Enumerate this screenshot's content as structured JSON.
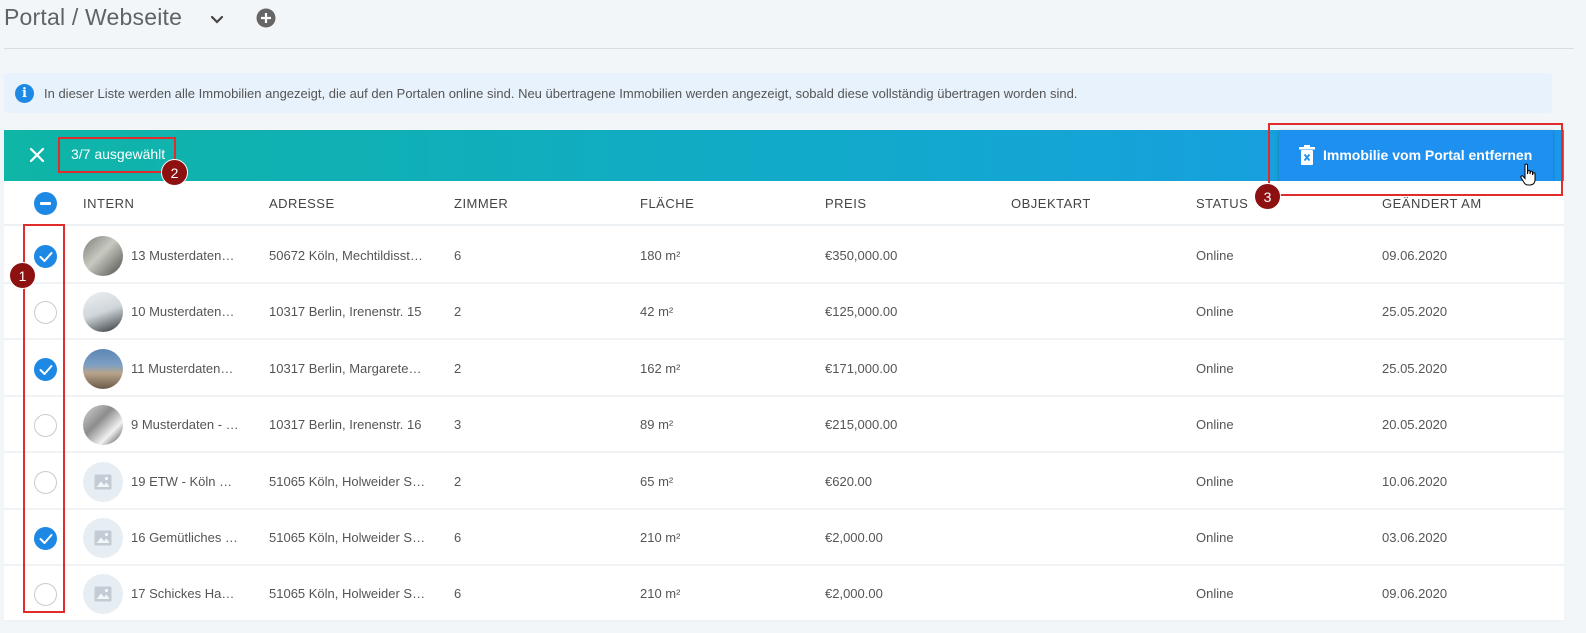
{
  "header": {
    "title": "Portal / Webseite",
    "dropdown_icon": "chevron-down-icon",
    "add_icon": "plus-circle-icon"
  },
  "info": {
    "text": "In dieser Liste werden alle Immobilien angezeigt, die auf den Portalen online sind. Neu übertragene Immobilien werden angezeigt, sobald diese vollständig übertragen worden sind."
  },
  "selection_bar": {
    "selected_text": "3/7 ausgewählt",
    "remove_button": "Immobilie vom Portal entfernen"
  },
  "table": {
    "columns": [
      "INTERN",
      "ADRESSE",
      "ZIMMER",
      "FLÄCHE",
      "PREIS",
      "OBJEKTART",
      "STATUS",
      "GEÄNDERT AM"
    ],
    "rows": [
      {
        "selected": true,
        "intern": "13  Musterdaten…",
        "adresse": "50672 Köln, Mechtildisst…",
        "zimmer": "6",
        "flaeche": "180 m²",
        "preis": "€350,000.00",
        "objektart": "",
        "status": "Online",
        "geaendert": "09.06.2020",
        "image": "photo"
      },
      {
        "selected": false,
        "intern": "10  Musterdaten…",
        "adresse": "10317 Berlin, Irenenstr. 15",
        "zimmer": "2",
        "flaeche": "42 m²",
        "preis": "€125,000.00",
        "objektart": "",
        "status": "Online",
        "geaendert": "25.05.2020",
        "image": "photo"
      },
      {
        "selected": true,
        "intern": "11  Musterdaten…",
        "adresse": "10317 Berlin, Margarete…",
        "zimmer": "2",
        "flaeche": "162 m²",
        "preis": "€171,000.00",
        "objektart": "",
        "status": "Online",
        "geaendert": "25.05.2020",
        "image": "photo"
      },
      {
        "selected": false,
        "intern": "9  Musterdaten - …",
        "adresse": "10317 Berlin, Irenenstr. 16",
        "zimmer": "3",
        "flaeche": "89 m²",
        "preis": "€215,000.00",
        "objektart": "",
        "status": "Online",
        "geaendert": "20.05.2020",
        "image": "photo"
      },
      {
        "selected": false,
        "intern": "19  ETW - Köln …",
        "adresse": "51065 Köln, Holweider S…",
        "zimmer": "2",
        "flaeche": "65 m²",
        "preis": "€620.00",
        "objektart": "",
        "status": "Online",
        "geaendert": "10.06.2020",
        "image": "placeholder"
      },
      {
        "selected": true,
        "intern": "16  Gemütliches …",
        "adresse": "51065 Köln, Holweider S…",
        "zimmer": "6",
        "flaeche": "210 m²",
        "preis": "€2,000.00",
        "objektart": "",
        "status": "Online",
        "geaendert": "03.06.2020",
        "image": "placeholder"
      },
      {
        "selected": false,
        "intern": "17  Schickes Ha…",
        "adresse": "51065 Köln, Holweider S…",
        "zimmer": "6",
        "flaeche": "210 m²",
        "preis": "€2,000.00",
        "objektart": "",
        "status": "Online",
        "geaendert": "09.06.2020",
        "image": "placeholder"
      }
    ]
  },
  "annotations": {
    "badge1": "1",
    "badge2": "2",
    "badge3": "3"
  },
  "colors": {
    "accent": "#1e88e5",
    "bar_start": "#0fb5a6",
    "bar_end": "#1b98ea",
    "annotation": "#e02c2c"
  }
}
